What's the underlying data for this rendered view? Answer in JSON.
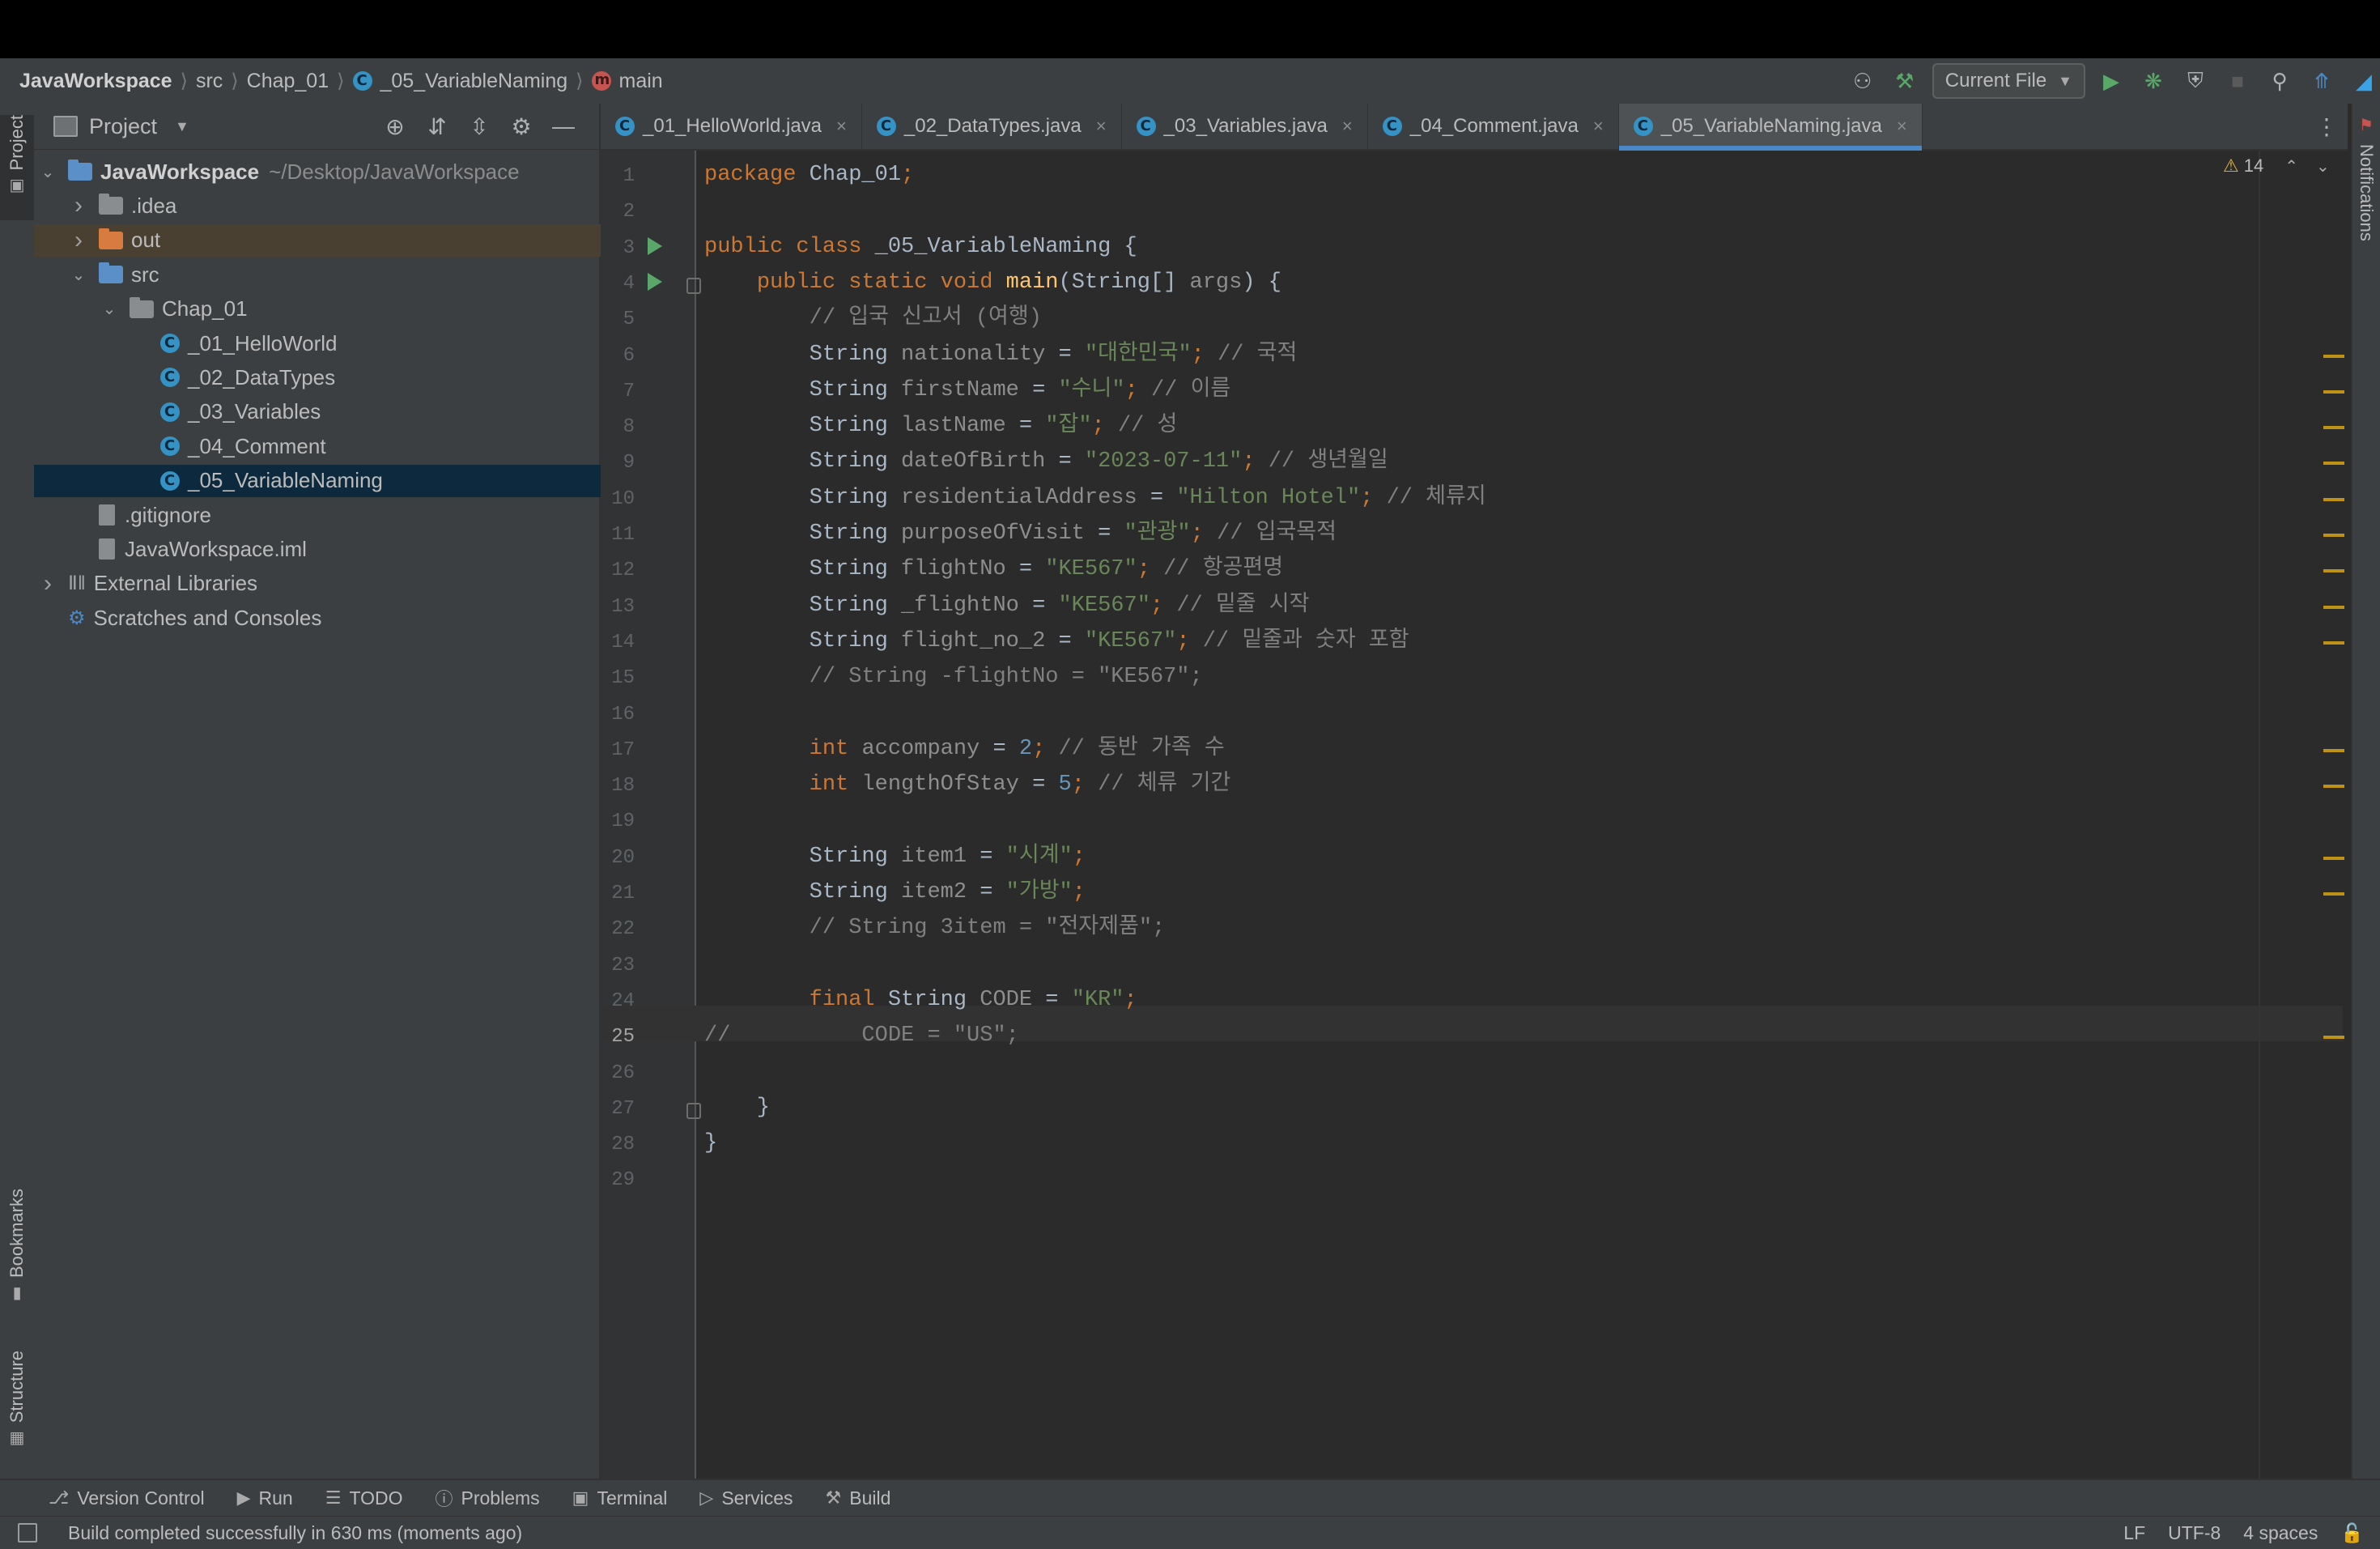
{
  "breadcrumb": [
    {
      "label": "JavaWorkspace",
      "icon": ""
    },
    {
      "label": "src",
      "icon": ""
    },
    {
      "label": "Chap_01",
      "icon": ""
    },
    {
      "label": "_05_VariableNaming",
      "icon": "class-icon"
    },
    {
      "label": "main",
      "icon": "method-icon"
    }
  ],
  "run_config": {
    "label": "Current File"
  },
  "left_strip": {
    "project": "Project",
    "bookmarks": "Bookmarks",
    "structure": "Structure"
  },
  "right_strip": {
    "notifications": "Notifications"
  },
  "project_pane": {
    "title": "Project",
    "tree": [
      {
        "label": "JavaWorkspace",
        "detail": "~/Desktop/JavaWorkspace",
        "depth": 0,
        "icon": "module-folder-icon",
        "expanded": true,
        "kind": "root"
      },
      {
        "label": ".idea",
        "depth": 1,
        "icon": "folder-icon",
        "expanded": false,
        "kind": "folder"
      },
      {
        "label": "out",
        "depth": 1,
        "icon": "excluded-folder-icon",
        "expanded": false,
        "kind": "excluded"
      },
      {
        "label": "src",
        "depth": 1,
        "icon": "source-folder-icon",
        "expanded": true,
        "kind": "src"
      },
      {
        "label": "Chap_01",
        "depth": 2,
        "icon": "package-icon",
        "expanded": true,
        "kind": "package"
      },
      {
        "label": "_01_HelloWorld",
        "depth": 3,
        "icon": "class-icon",
        "kind": "class"
      },
      {
        "label": "_02_DataTypes",
        "depth": 3,
        "icon": "class-icon",
        "kind": "class"
      },
      {
        "label": "_03_Variables",
        "depth": 3,
        "icon": "class-icon",
        "kind": "class"
      },
      {
        "label": "_04_Comment",
        "depth": 3,
        "icon": "class-icon",
        "kind": "class"
      },
      {
        "label": "_05_VariableNaming",
        "depth": 3,
        "icon": "class-icon",
        "kind": "class",
        "selected": true
      },
      {
        "label": ".gitignore",
        "depth": 1,
        "icon": "file-icon",
        "kind": "file"
      },
      {
        "label": "JavaWorkspace.iml",
        "depth": 1,
        "icon": "file-icon",
        "kind": "file"
      },
      {
        "label": "External Libraries",
        "depth": 0,
        "icon": "library-icon",
        "expanded": false,
        "kind": "lib"
      },
      {
        "label": "Scratches and Consoles",
        "depth": 0,
        "icon": "scratches-icon",
        "kind": "scratch"
      }
    ]
  },
  "tabs": [
    {
      "label": "_01_HelloWorld.java",
      "active": false
    },
    {
      "label": "_02_DataTypes.java",
      "active": false
    },
    {
      "label": "_03_Variables.java",
      "active": false
    },
    {
      "label": "_04_Comment.java",
      "active": false
    },
    {
      "label": "_05_VariableNaming.java",
      "active": true
    }
  ],
  "editor": {
    "warnings_count": "14",
    "current_line": 25,
    "lines": [
      "package Chap_01;",
      "",
      "public class _05_VariableNaming {",
      "    public static void main(String[] args) {",
      "        // 입국 신고서 (여행)",
      "        String nationality = \"대한민국\"; // 국적",
      "        String firstName = \"수니\"; // 이름",
      "        String lastName = \"잡\"; // 성",
      "        String dateOfBirth = \"2023-07-11\"; // 생년월일",
      "        String residentialAddress = \"Hilton Hotel\"; // 체류지",
      "        String purposeOfVisit = \"관광\"; // 입국목적",
      "        String flightNo = \"KE567\"; // 항공편명",
      "        String _flightNo = \"KE567\"; // 밑줄 시작",
      "        String flight_no_2 = \"KE567\"; // 밑줄과 숫자 포함",
      "        // String -flightNo = \"KE567\";",
      "",
      "        int accompany = 2; // 동반 가족 수",
      "        int lengthOfStay = 5; // 체류 기간",
      "",
      "        String item1 = \"시계\";",
      "        String item2 = \"가방\";",
      "        // String 3item = \"전자제품\";",
      "",
      "        final String CODE = \"KR\";",
      "//          CODE = \"US\";",
      "",
      "    }",
      "}",
      ""
    ]
  },
  "bottom_tools": [
    {
      "label": "Version Control",
      "icon": "branch-icon"
    },
    {
      "label": "Run",
      "icon": "run-icon"
    },
    {
      "label": "TODO",
      "icon": "list-icon"
    },
    {
      "label": "Problems",
      "icon": "problems-icon"
    },
    {
      "label": "Terminal",
      "icon": "terminal-icon"
    },
    {
      "label": "Services",
      "icon": "services-icon"
    },
    {
      "label": "Build",
      "icon": "hammer-icon"
    }
  ],
  "status": {
    "message": "Build completed successfully in 630 ms (moments ago)",
    "line_sep": "LF",
    "encoding": "UTF-8",
    "indent": "4 spaces"
  },
  "colors": {
    "accent": "#4a88c7",
    "run_green": "#59a869",
    "warning": "#be9117"
  }
}
